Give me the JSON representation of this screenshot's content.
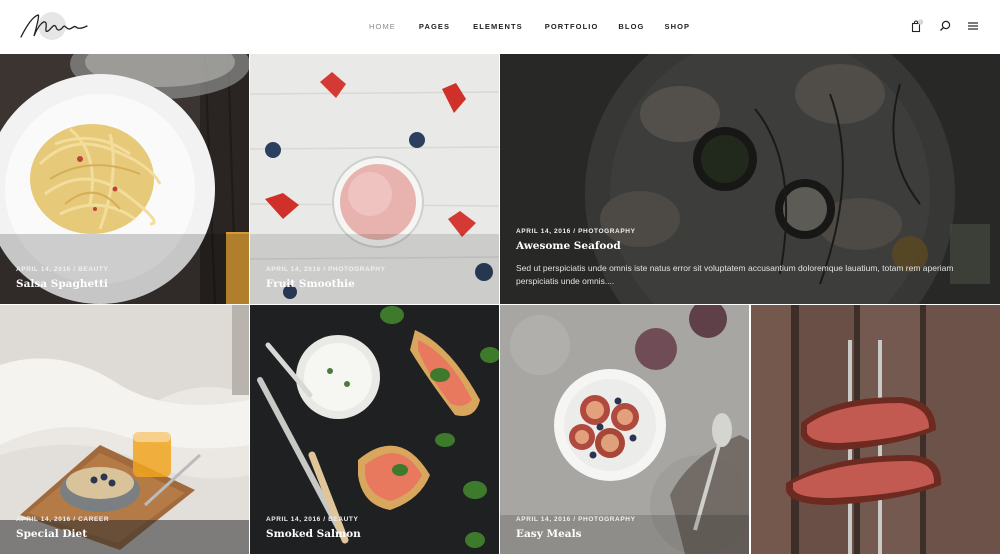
{
  "header": {
    "logo_alt": "signature logo",
    "nav": [
      {
        "label": "HOME",
        "active": true
      },
      {
        "label": "PAGES",
        "active": false
      },
      {
        "label": "ELEMENTS",
        "active": false
      },
      {
        "label": "PORTFOLIO",
        "active": false
      },
      {
        "label": "BLOG",
        "active": false
      },
      {
        "label": "SHOP",
        "active": false
      }
    ],
    "icons": [
      "shopping-bag-icon",
      "search-icon",
      "menu-icon"
    ],
    "cart_count": "0"
  },
  "posts": [
    {
      "date": "APRIL 14, 2016",
      "category": "BEAUTY",
      "title": "Salsa Spaghetti"
    },
    {
      "date": "APRIL 14, 2016",
      "category": "PHOTOGRAPHY",
      "title": "Fruit Smoothie"
    },
    {
      "date": "APRIL 14, 2016",
      "category": "PHOTOGRAPHY",
      "title": "Awesome Seafood",
      "excerpt": "Sed ut perspiciatis unde omnis iste natus error sit voluptatem accusantium doloremque lauatium, totam rem aperiam perspiciatis unde omnis...."
    },
    {
      "date": "APRIL 14, 2016",
      "category": "CAREER",
      "title": "Special Diet"
    },
    {
      "date": "APRIL 14, 2016",
      "category": "BEAUTY",
      "title": "Smoked Salmon"
    },
    {
      "date": "APRIL 14, 2016",
      "category": "PHOTOGRAPHY",
      "title": "Easy Meals"
    }
  ],
  "meta_separator": " / ",
  "colors": {
    "nav_active": "#8a8a8a",
    "nav_text": "#222222",
    "caption_text": "#ffffff"
  }
}
